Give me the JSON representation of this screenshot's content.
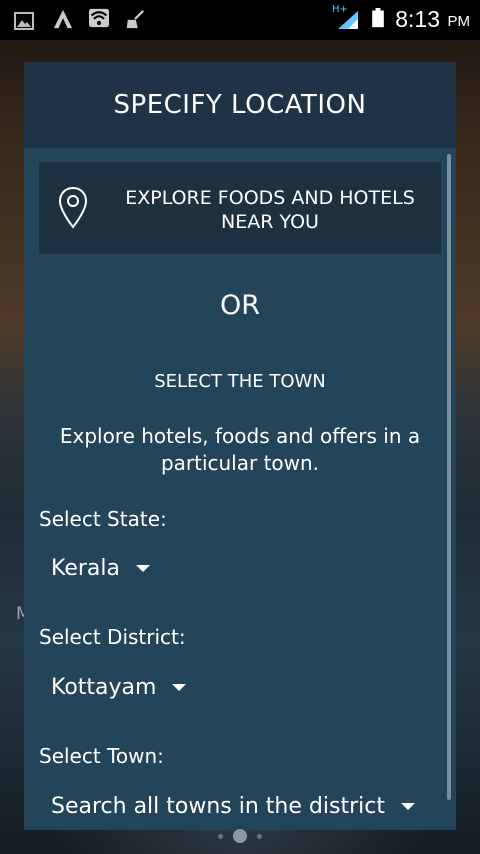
{
  "status_bar": {
    "network_type": "H+",
    "time": "8:13",
    "ampm": "PM",
    "icons": [
      "gallery-icon",
      "app-a-icon",
      "wifi-icon",
      "broom-icon",
      "signal-icon",
      "battery-icon"
    ]
  },
  "background": {
    "partial_letter": "M"
  },
  "dialog": {
    "title": "SPECIFY LOCATION",
    "explore_button_label": "EXPLORE FOODS AND HOTELS NEAR YOU",
    "or_text": "OR",
    "select_town_heading": "SELECT THE TOWN",
    "description": "Explore hotels, foods and offers in a particular town.",
    "state": {
      "label": "Select State:",
      "value": "Kerala"
    },
    "district": {
      "label": "Select District:",
      "value": "Kottayam"
    },
    "town": {
      "label": "Select Town:",
      "value": "Search all towns in the district"
    }
  },
  "pager": {
    "dot_count": 3,
    "active_index": 1
  },
  "colors": {
    "dialog_bg": "#24445a",
    "header_bg": "#1e3346",
    "button_bg": "#1d3141",
    "text": "#ffffff"
  }
}
